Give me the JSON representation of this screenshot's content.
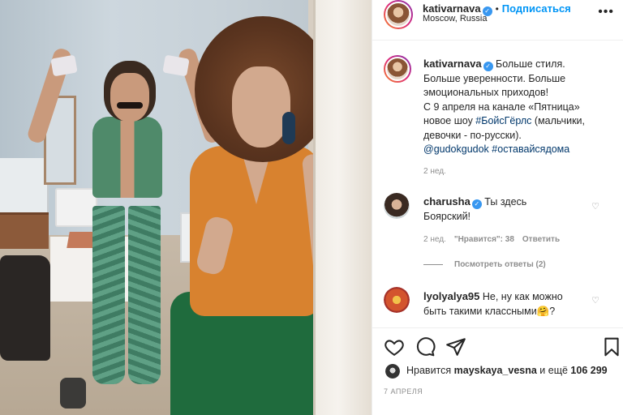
{
  "header": {
    "username": "kativarnava",
    "follow_label": "Подписаться",
    "location": "Moscow, Russia",
    "more_icon": "more-horizontal-icon"
  },
  "caption": {
    "username": "kativarnava",
    "line1": "Больше стиля.",
    "line2": "Больше уверенности. Больше",
    "line3": "эмоциональных приходов!",
    "line4": "С 9 апреля на канале «Пятница»",
    "line5a": "новое шоу ",
    "hashtag1": "#БойсГёрлс",
    "line5b": " (мальчики,",
    "line6": "девочки - по-русски).",
    "mention": "@gudokgudok",
    "hashtag2": "#оставайсядома",
    "time": "2 нед."
  },
  "comments": [
    {
      "username": "charusha",
      "text_line1": "Ты здесь",
      "text_line2": "Боярский!",
      "time": "2 нед.",
      "likes": "\"Нравится\": 38",
      "reply_label": "Ответить",
      "view_replies": "Посмотреть ответы (2)"
    },
    {
      "username": "lyolyalya95",
      "text_line1": "Не, ну как можно",
      "text_line2": "быть такими классными🤗?"
    }
  ],
  "likes": {
    "prefix": "Нравится ",
    "user": "mayskaya_vesna",
    "middle": " и ещё ",
    "count": "106 299"
  },
  "date": "7 АПРЕЛЯ",
  "colors": {
    "link": "#0095f6",
    "hashtag": "#00376b",
    "muted": "#8e8e8e",
    "verified": "#3897f0"
  },
  "icons": [
    "heart-icon",
    "comment-icon",
    "share-icon",
    "bookmark-icon",
    "verified-badge-icon",
    "small-heart-icon"
  ]
}
